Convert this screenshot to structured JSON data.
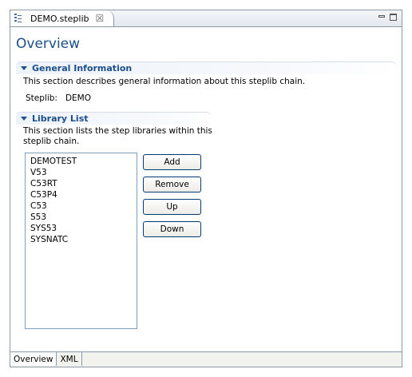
{
  "tab": {
    "title": "DEMO.steplib",
    "close_glyph": "☒"
  },
  "page": {
    "title": "Overview"
  },
  "general_info": {
    "title": "General Information",
    "description": "This section describes general information about this steplib chain.",
    "steplib_label": "Steplib:",
    "steplib_value": "DEMO"
  },
  "library_list": {
    "title": "Library List",
    "description_line1": "This section lists the step libraries within this",
    "description_line2": "steplib chain.",
    "items": [
      "DEMOTEST",
      "V53",
      "C53RT",
      "C53P4",
      "C53",
      "S53",
      "SYS53",
      "SYSNATC"
    ],
    "buttons": {
      "add": "Add",
      "remove": "Remove",
      "up": "Up",
      "down": "Down"
    }
  },
  "bottom_tabs": [
    "Overview",
    "XML"
  ],
  "colors": {
    "section_title": "#1c4f8a",
    "border": "#8c9aa8"
  }
}
